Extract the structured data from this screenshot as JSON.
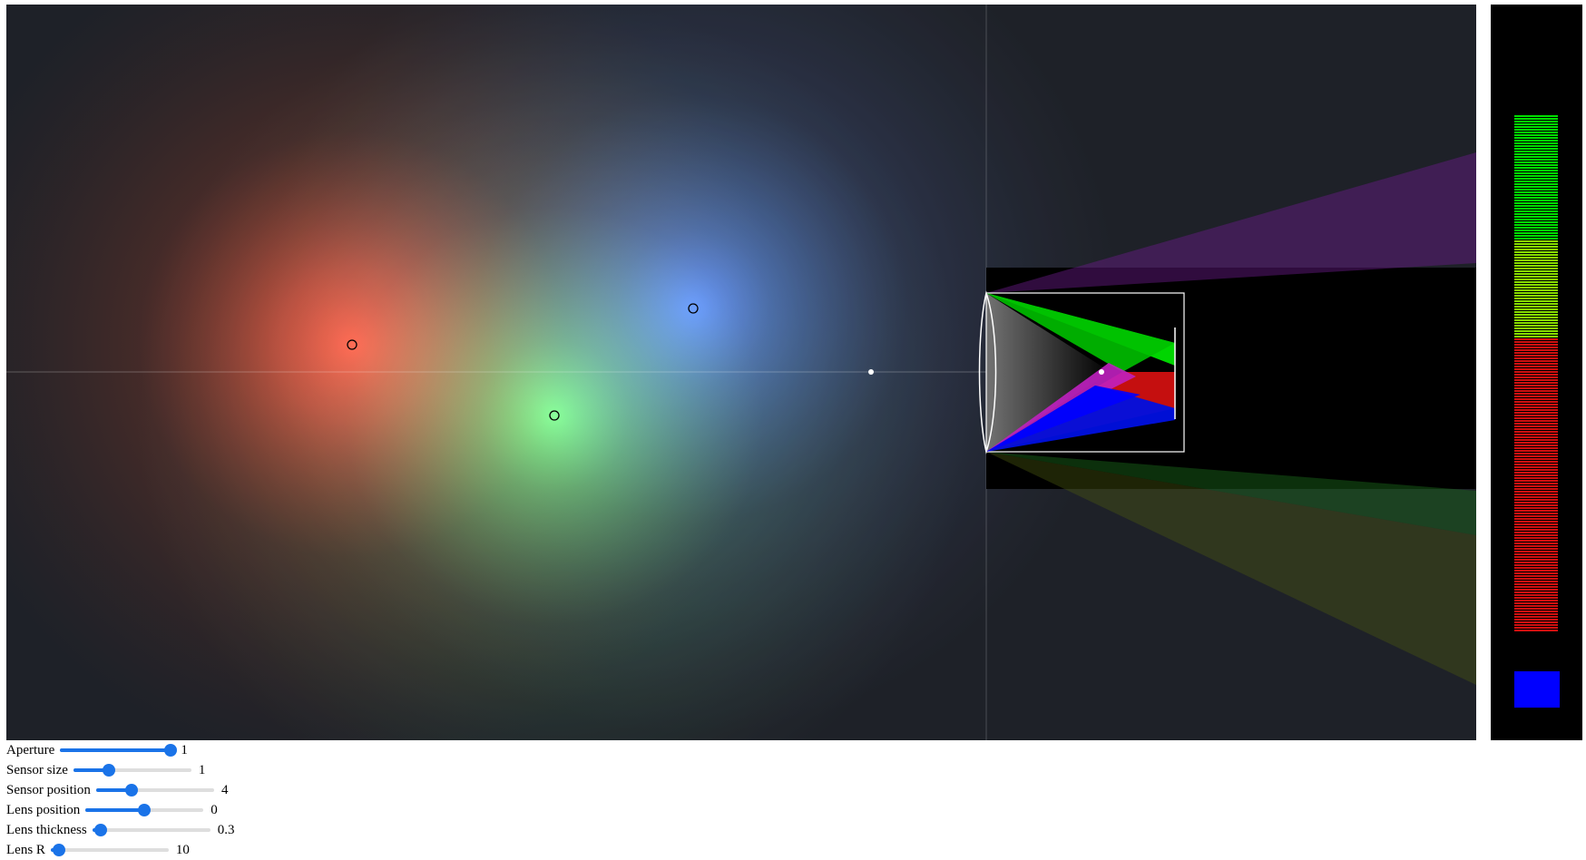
{
  "scene": {
    "background": "#1e2128",
    "light_sources": [
      {
        "name": "red",
        "color": "#ff5040"
      },
      {
        "name": "green",
        "color": "#50ff60"
      },
      {
        "name": "blue",
        "color": "#4070ff"
      }
    ]
  },
  "sensor_readout": {
    "background": "#000000",
    "colors": {
      "green": "#00e000",
      "yellow_green": "#88e000",
      "red": "#d01010",
      "blue": "#0000ff"
    }
  },
  "controls": [
    {
      "label": "Aperture",
      "value": "1",
      "level": 0.97
    },
    {
      "label": "Sensor size",
      "value": "1",
      "level": 0.3
    },
    {
      "label": "Sensor position",
      "value": "4",
      "level": 0.3
    },
    {
      "label": "Lens position",
      "value": "0",
      "level": 0.5
    },
    {
      "label": "Lens thickness",
      "value": "0.3",
      "level": 0.07
    },
    {
      "label": "Lens R",
      "value": "10",
      "level": 0.07
    }
  ],
  "accent_color": "#1a73e8"
}
